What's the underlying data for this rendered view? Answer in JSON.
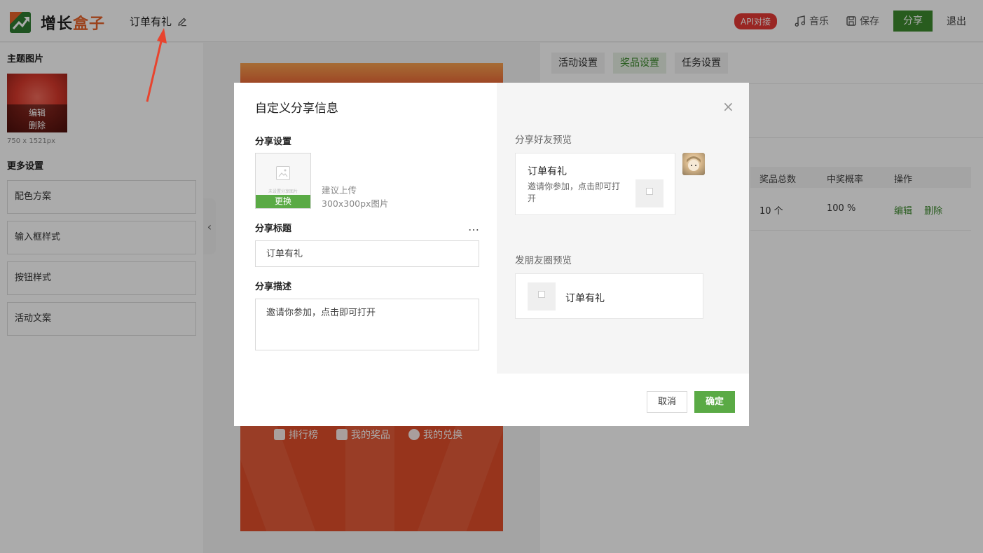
{
  "header": {
    "logo_text_main": "增长",
    "logo_text_accent": "盒子",
    "doc_title": "订单有礼",
    "api_badge": "API对接",
    "music_label": "音乐",
    "save_label": "保存",
    "share_label": "分享",
    "logout_label": "退出"
  },
  "sidebar": {
    "theme_title": "主题图片",
    "edit_label": "编辑",
    "delete_label": "删除",
    "image_size": "750 x 1521px",
    "more_title": "更多设置",
    "items": [
      "配色方案",
      "输入框样式",
      "按钮样式",
      "活动文案"
    ]
  },
  "phone": {
    "bar": [
      "排行榜",
      "我的奖品",
      "我的兑换"
    ]
  },
  "right_panel": {
    "tabs": [
      "活动设置",
      "奖品设置",
      "任务设置"
    ],
    "active_tab": "奖品设置",
    "table": {
      "headers": [
        "奖品总数",
        "中奖概率",
        "操作"
      ],
      "rows": [
        {
          "total": "10 个",
          "prob": "100 %",
          "edit": "编辑",
          "delete": "删除"
        }
      ]
    }
  },
  "modal": {
    "title": "自定义分享信息",
    "share_settings_label": "分享设置",
    "upload_placeholder": "未设置分享图片",
    "replace_label": "更换",
    "upload_tip": "建议上传300x300px图片",
    "share_title_label": "分享标题",
    "more_icon": "…",
    "share_title_value": "订单有礼",
    "share_desc_label": "分享描述",
    "share_desc_value": "邀请你参加，点击即可打开",
    "friend_preview_label": "分享好友预览",
    "friend_card_title": "订单有礼",
    "friend_card_desc": "邀请你参加，点击即可打开",
    "moments_preview_label": "发朋友圈预览",
    "moments_card_title": "订单有礼",
    "close_icon": "×",
    "cancel_label": "取消",
    "ok_label": "确定"
  },
  "colors": {
    "brand_green": "#3d8a2e",
    "button_green": "#5aaa45",
    "badge_red": "#e53935",
    "accent_orange": "#e8632b"
  }
}
